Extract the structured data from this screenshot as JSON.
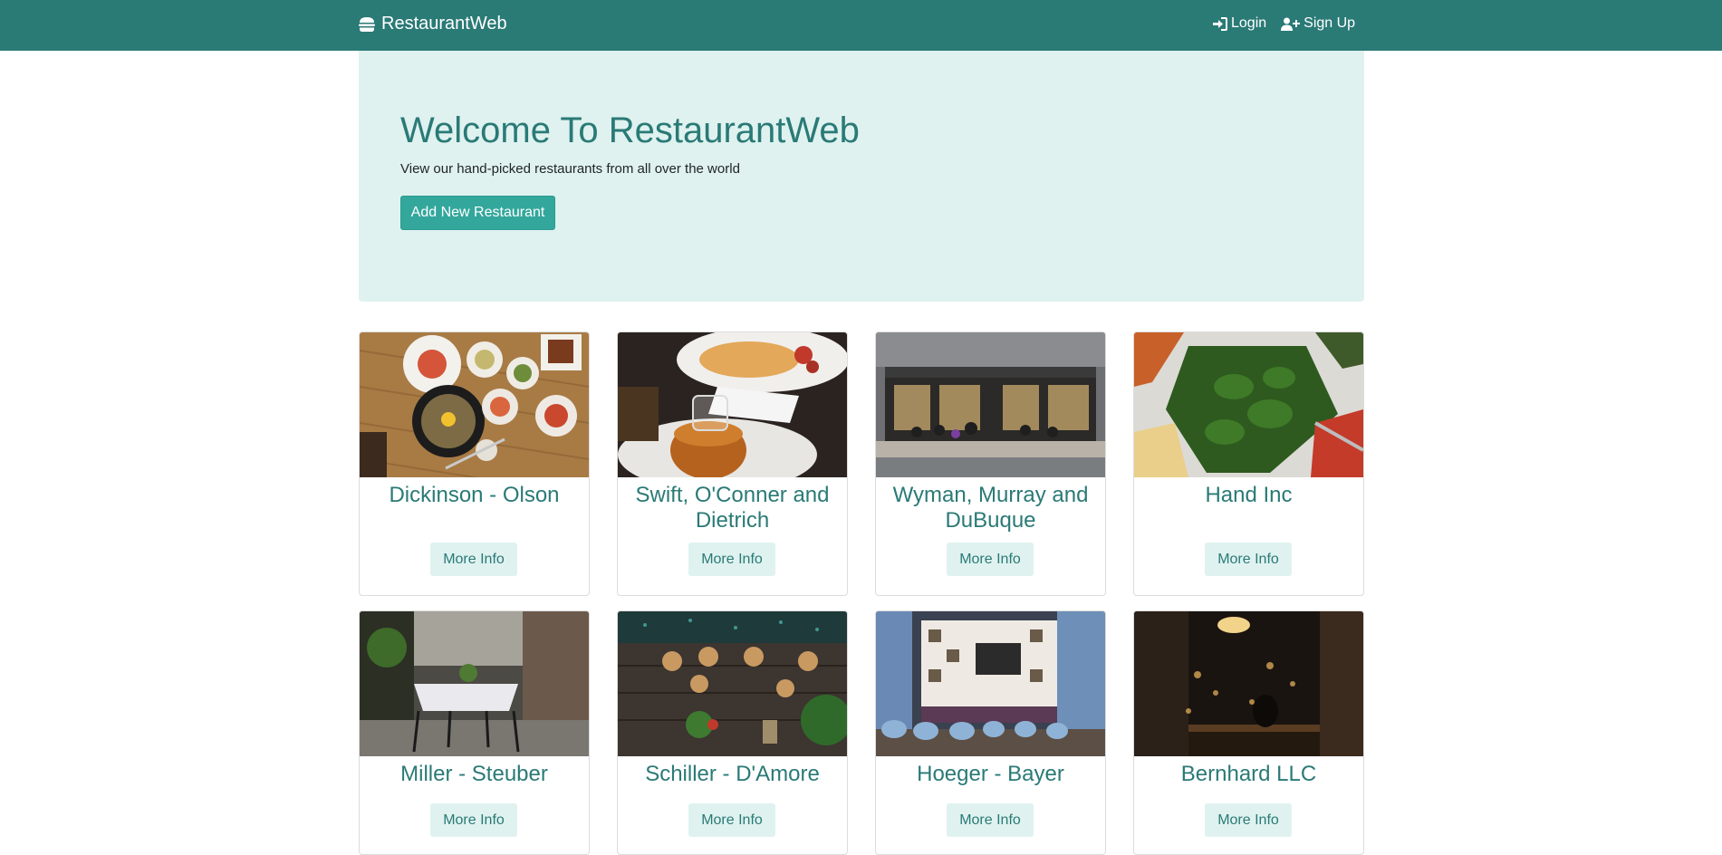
{
  "navbar": {
    "brand": "RestaurantWeb",
    "brand_icon": "hamburger-icon",
    "login_label": "Login",
    "login_icon": "sign-in-icon",
    "signup_label": "Sign Up",
    "signup_icon": "user-plus-icon"
  },
  "hero": {
    "title": "Welcome To RestaurantWeb",
    "subtitle": "View our hand-picked restaurants from all over the world",
    "add_button": "Add New Restaurant"
  },
  "colors": {
    "primary": "#2a7a76",
    "accent_button": "#33a79c",
    "light_bg": "#dff2f0"
  },
  "restaurants": [
    {
      "name": "Dickinson - Olson",
      "button": "More Info"
    },
    {
      "name": "Swift, O'Conner and Dietrich",
      "button": "More Info"
    },
    {
      "name": "Wyman, Murray and DuBuque",
      "button": "More Info"
    },
    {
      "name": "Hand Inc",
      "button": "More Info"
    },
    {
      "name": "Miller - Steuber",
      "button": "More Info"
    },
    {
      "name": "Schiller - D'Amore",
      "button": "More Info"
    },
    {
      "name": "Hoeger - Bayer",
      "button": "More Info"
    },
    {
      "name": "Bernhard LLC",
      "button": "More Info"
    }
  ]
}
